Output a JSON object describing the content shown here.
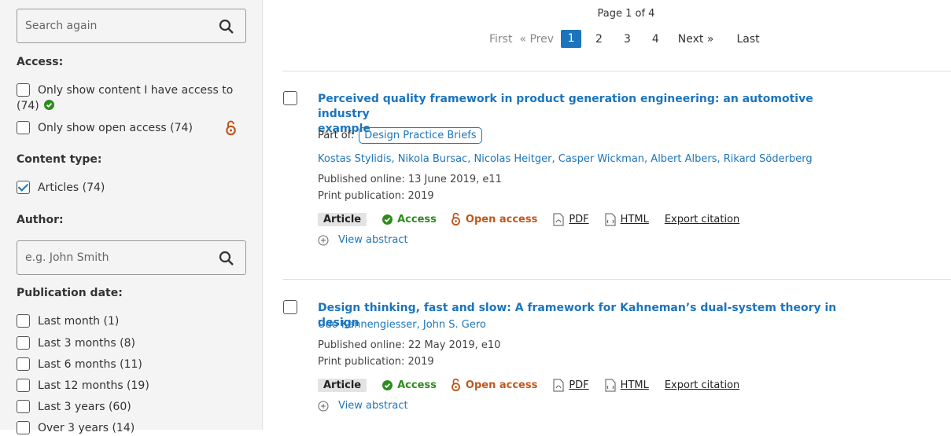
{
  "sidebar": {
    "search_again_placeholder": "Search again",
    "access_title": "Access:",
    "access_items": [
      {
        "label_line1": "Only show content I have access to",
        "label_line2": "(74)",
        "checked": false
      },
      {
        "label": "Only show open access (74)",
        "checked": false
      }
    ],
    "content_type_title": "Content type:",
    "content_type_items": [
      {
        "label": "Articles (74)",
        "checked": true
      }
    ],
    "author_title": "Author:",
    "author_placeholder": "e.g. John Smith",
    "pubdate_title": "Publication date:",
    "pubdate_items": [
      {
        "label": "Last month (1)"
      },
      {
        "label": "Last 3 months (8)"
      },
      {
        "label": "Last 6 months (11)"
      },
      {
        "label": "Last 12 months (19)"
      },
      {
        "label": "Last 3 years (60)"
      },
      {
        "label": "Over 3 years (14)"
      }
    ]
  },
  "pagination": {
    "page_info": "Page 1 of 4",
    "first": "First",
    "prev": "« Prev",
    "pages": [
      "1",
      "2",
      "3",
      "4"
    ],
    "current": "1",
    "next": "Next »",
    "last": "Last"
  },
  "results": [
    {
      "title_line1": "Perceived quality framework in product generation engineering: an automotive industry",
      "title_line2": "example",
      "part_of_label": "Part of:",
      "part_of": "Design Practice Briefs",
      "authors": [
        "Kostas Stylidis",
        "Nikola Bursac",
        "Nicolas Heitger",
        "Casper Wickman",
        "Albert Albers",
        "Rikard Söderberg"
      ],
      "published_online": "Published online: 13 June 2019, e11",
      "print_publication": "Print publication: 2019",
      "type": "Article",
      "access": "Access",
      "open_access": "Open access",
      "pdf": "PDF",
      "html": "HTML",
      "export": "Export citation",
      "view_abstract": "View abstract"
    },
    {
      "title_line1": "Design thinking, fast and slow: A framework for Kahneman’s dual-system theory in design",
      "authors": [
        "Udo Kannengiesser",
        "John S. Gero"
      ],
      "published_online": "Published online: 22 May 2019, e10",
      "print_publication": "Print publication: 2019",
      "type": "Article",
      "access": "Access",
      "open_access": "Open access",
      "pdf": "PDF",
      "html": "HTML",
      "export": "Export citation",
      "view_abstract": "View abstract"
    }
  ],
  "colors": {
    "link": "#1c75bc",
    "access": "#2e8b1f",
    "open_access": "#c0571c"
  }
}
